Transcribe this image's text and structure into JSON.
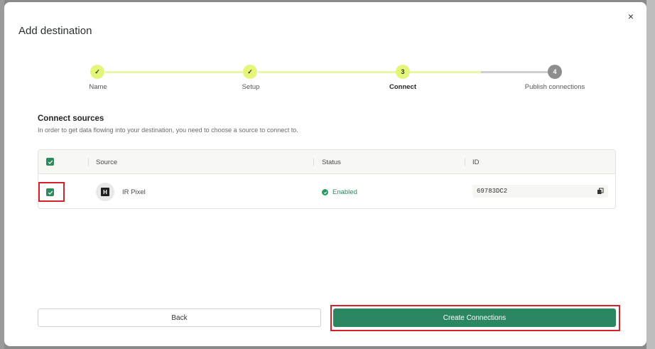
{
  "modal": {
    "title": "Add destination",
    "close_label": "×"
  },
  "stepper": {
    "steps": [
      {
        "label": "Name",
        "state": "done",
        "marker": "✓"
      },
      {
        "label": "Setup",
        "state": "done",
        "marker": "✓"
      },
      {
        "label": "Connect",
        "state": "active",
        "marker": "3"
      },
      {
        "label": "Publish connections",
        "state": "todo",
        "marker": "4"
      }
    ]
  },
  "section": {
    "title": "Connect sources",
    "subtitle": "In order to get data flowing into your destination, you need to choose a source to connect to."
  },
  "table": {
    "columns": [
      "Source",
      "Status",
      "ID"
    ],
    "rows": [
      {
        "checked": true,
        "source_icon": "H",
        "source": "IR Pixel",
        "status": "Enabled",
        "id": "69783DC2"
      }
    ]
  },
  "actions": {
    "back_label": "Back",
    "create_label": "Create Connections"
  },
  "colors": {
    "accent": "#2b8762",
    "step_done": "#e4f57a",
    "highlight": "#d6202a"
  }
}
